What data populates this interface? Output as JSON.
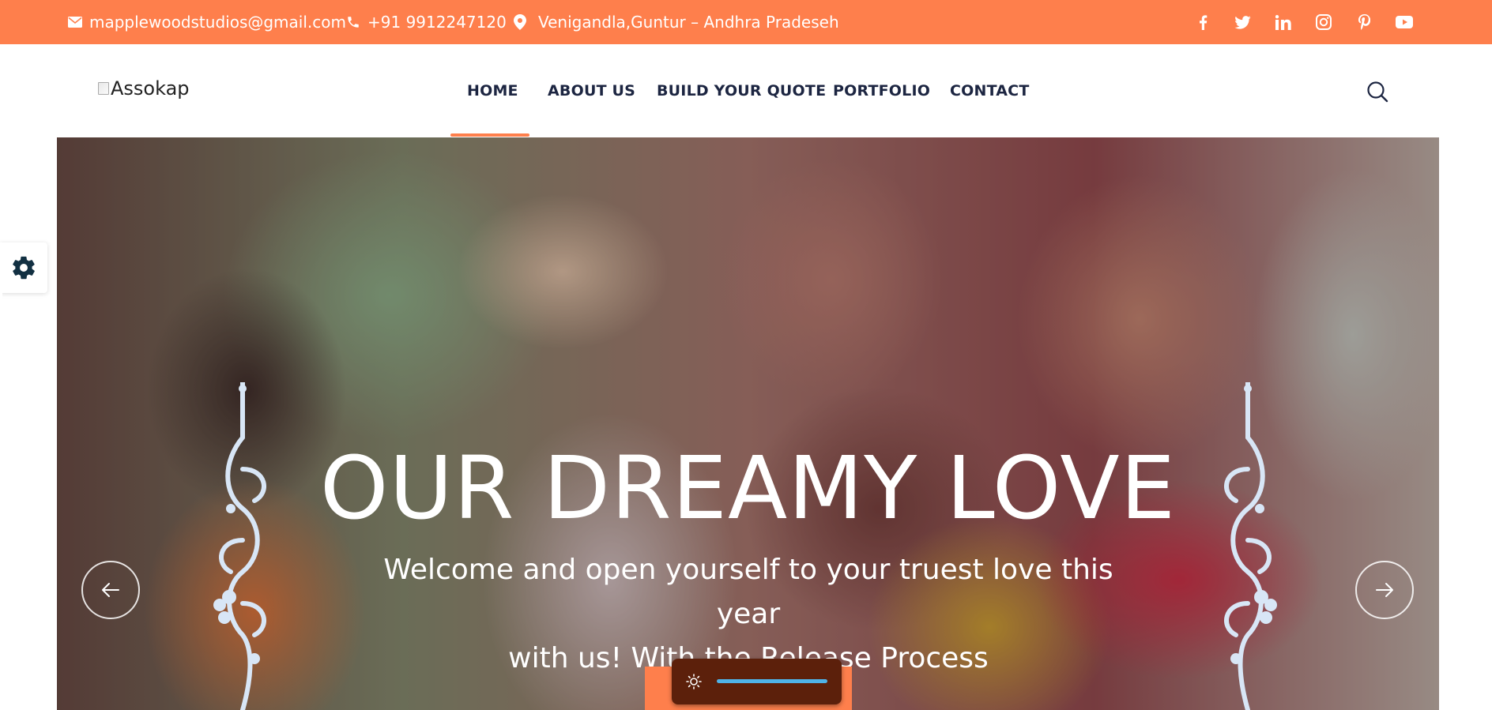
{
  "topbar": {
    "email": "mapplewoodstudios@gmail.com",
    "phone": "+91 9912247120",
    "address": "Venigandla,Guntur – Andhra Pradeseh",
    "social_icons": [
      "facebook-icon",
      "twitter-icon",
      "linkedin-icon",
      "instagram-icon",
      "pinterest-icon",
      "youtube-icon"
    ],
    "background_color": "#fe7f4c"
  },
  "header": {
    "logo_alt": "Assokap",
    "nav": [
      {
        "label": "HOME",
        "active": true
      },
      {
        "label": "ABOUT US",
        "active": false
      },
      {
        "label": "BUILD YOUR QUOTE",
        "active": false
      },
      {
        "label": "PORTFOLIO",
        "active": false
      },
      {
        "label": "CONTACT",
        "active": false
      }
    ],
    "accent_color": "#fe7f4c",
    "text_color": "#1c2541"
  },
  "hero": {
    "title": "OUR DREAMY LOVE",
    "subtitle_line1": "Welcome and open yourself to your truest love this year",
    "subtitle_line2": "with us! With the Release Process"
  },
  "widgets": {
    "theme_toggle_icon": "sun-icon",
    "settings_icon": "gear-icon",
    "toggle_color": "#4fb3e8"
  }
}
